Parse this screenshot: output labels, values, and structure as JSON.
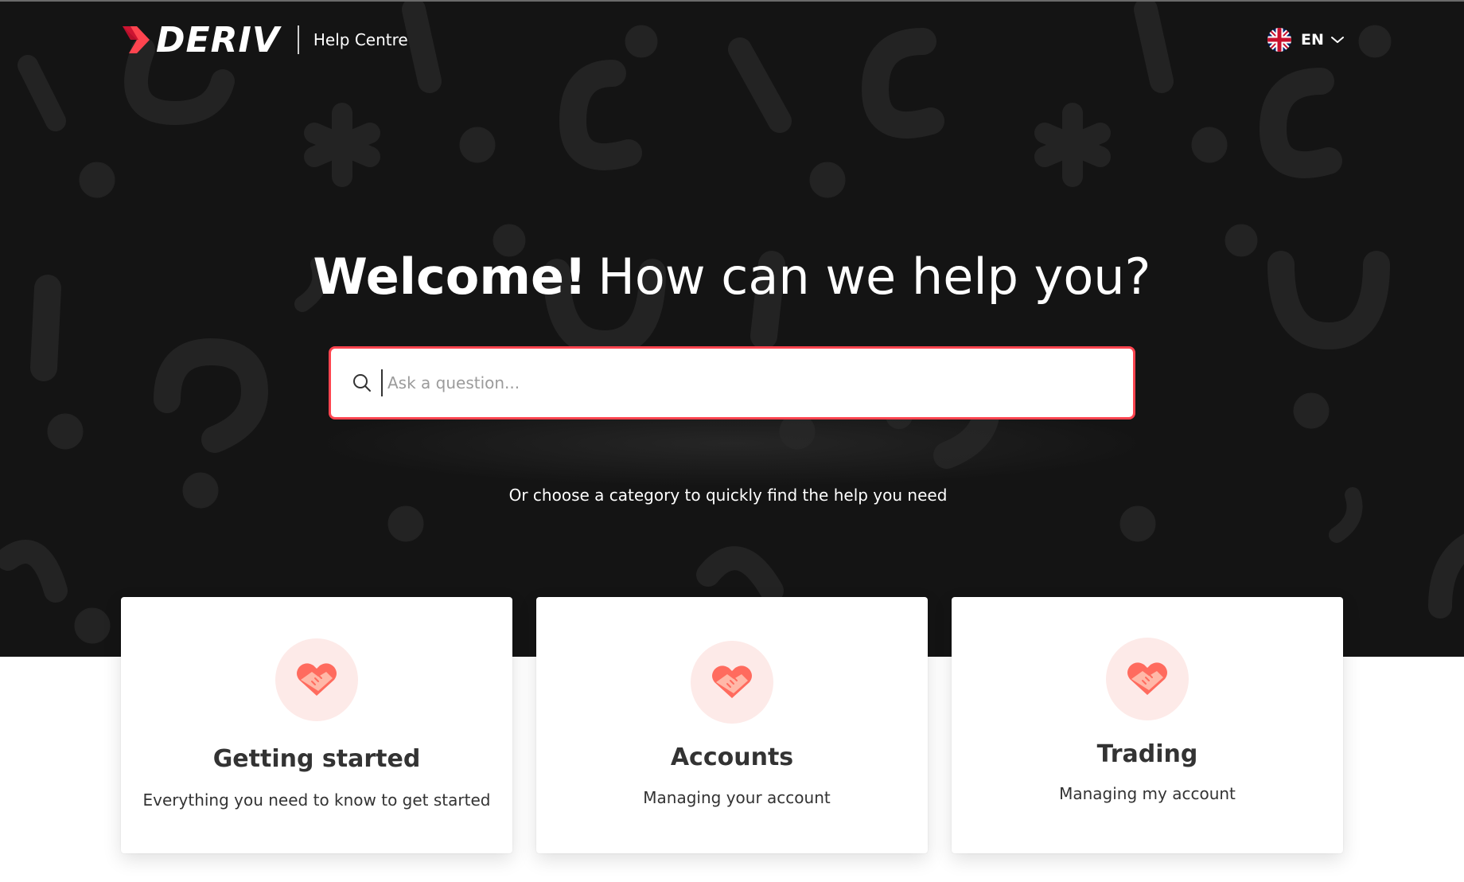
{
  "header": {
    "brand": "DERIV",
    "section": "Help Centre",
    "language": {
      "code": "EN",
      "flag_icon": "uk-flag-icon"
    }
  },
  "hero": {
    "headline_strong": "Welcome!",
    "headline_rest": "How can we help you?",
    "search_placeholder": "Ask a question...",
    "subtext": "Or choose a category to quickly find the help you need"
  },
  "categories": [
    {
      "title": "Getting started",
      "description": "Everything you need to know to get started",
      "icon": "handshake-heart-icon"
    },
    {
      "title": "Accounts",
      "description": "Managing your account",
      "icon": "handshake-heart-icon"
    },
    {
      "title": "Trading",
      "description": "Managing my account",
      "icon": "handshake-heart-icon"
    }
  ],
  "colors": {
    "hero_bg": "#141414",
    "accent": "#ff444f",
    "icon_bg": "#fdeae8",
    "text_dark": "#333333"
  }
}
